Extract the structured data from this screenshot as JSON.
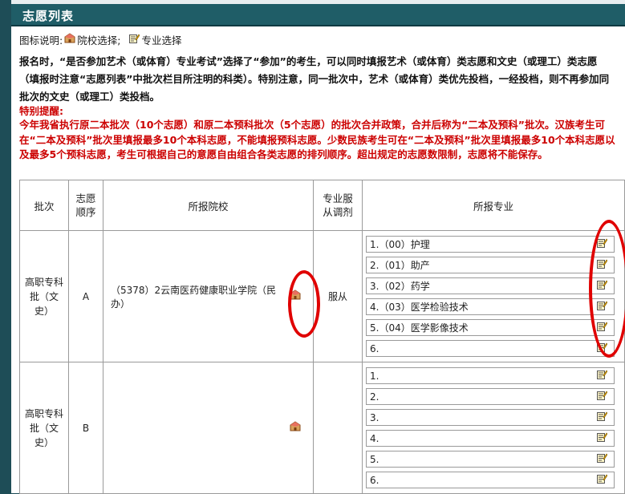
{
  "header": {
    "title": "志愿列表"
  },
  "legend": {
    "prefix": "图标说明:",
    "school_label": "院校选择;",
    "major_label": "专业选择"
  },
  "notice": "报名时，“是否参加艺术（或体育）专业考试”选择了“参加”的考生，可以同时填报艺术（或体育）类志愿和文史（或理工）类志愿（填报时注意“志愿列表”中批次栏目所注明的科类）。特别注意，同一批次中，艺术（或体育）类优先投档，一经投档，则不再参加同批次的文史（或理工）类投档。",
  "reminder": {
    "title": "特别提醒:",
    "text": "今年我省执行原二本批次（10个志愿）和原二本预科批次（5个志愿）的批次合并政策，合并后称为“二本及预科”批次。汉族考生可在“二本及预科”批次里填报最多10个本科志愿，不能填报预科志愿。少数民族考生可在“二本及预科”批次里填报最多10个本科志愿以及最多5个预科志愿，考生可根据自己的意愿自由组合各类志愿的排列顺序。超出规定的志愿数限制，志愿将不能保存。"
  },
  "table": {
    "headers": {
      "batch": "批次",
      "order": "志愿顺序",
      "school": "所报院校",
      "adjust": "专业服从调剂",
      "majors": "所报专业"
    },
    "rows": [
      {
        "batch": "高职专科批（文史）",
        "order": "A",
        "school": "（5378）2云南医药健康职业学院（民办）",
        "adjust": "服从",
        "majors": [
          "1.（00）护理",
          "2.（01）助产",
          "3.（02）药学",
          "4.（03）医学检验技术",
          "5.（04）医学影像技术",
          "6."
        ]
      },
      {
        "batch": "高职专科批（文史）",
        "order": "B",
        "school": "",
        "adjust": "",
        "majors": [
          "1.",
          "2.",
          "3.",
          "4.",
          "5.",
          "6."
        ]
      }
    ]
  },
  "icons": {
    "school_icon": "house-icon",
    "major_icon": "edit-note-icon"
  },
  "colors": {
    "title_bar": "#1f5d67",
    "reminder": "#cc0000",
    "annotation_ring": "#e00000"
  }
}
